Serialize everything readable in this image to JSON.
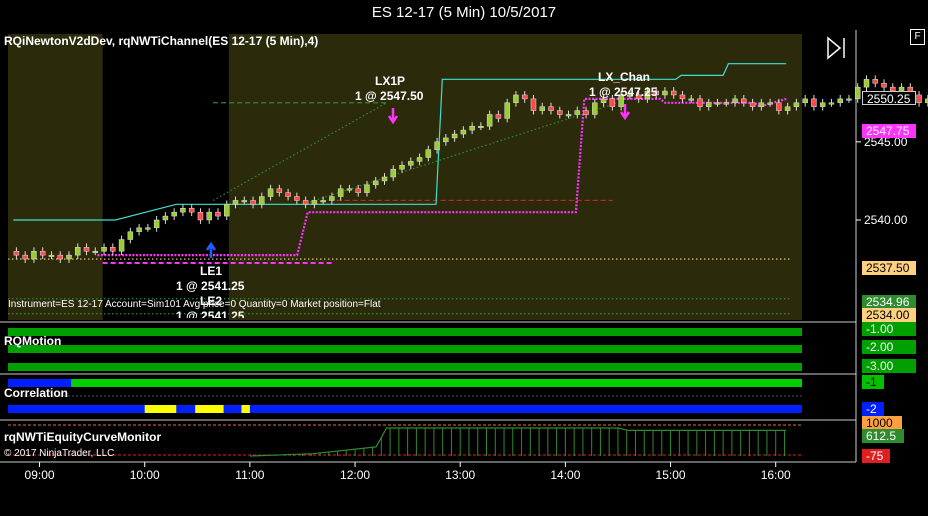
{
  "window": {
    "title": "ES 12-17 (5 Min)  10/5/2017",
    "f_button": "F"
  },
  "panels": {
    "price_title": "RQiNewtonV2dDev, rqNWTiChannel(ES 12-17 (5 Min),4)",
    "motion_title": "RQMotion",
    "correlation_title": "Correlation",
    "equity_title": "rqNWTiEquityCurveMonitor",
    "status_line": "Instrument=ES 12-17  Account=Sim101  Avg price=0 Quantity=0 Market position=Flat",
    "copyright": "© 2017 NinjaTrader, LLC"
  },
  "trades": {
    "entry_1": {
      "name": "LE1",
      "price": "1 @ 2541.25"
    },
    "entry_2": {
      "name": "LE2",
      "price": "1 @ 2541.25"
    },
    "exit_1": {
      "name": "LX1P",
      "price": "1 @ 2547.50"
    },
    "exit_2": {
      "name": "LX_Chan",
      "price": "1 @ 2547.25"
    }
  },
  "price_markers": {
    "last": "2550.25",
    "upper_channel": "2547.75",
    "level_orange": "2537.50",
    "level_green": "2534.96",
    "level_yellow": "2534.00"
  },
  "indicator_markers": {
    "motion": [
      "-1.00",
      "-2.00",
      "-3.00"
    ],
    "correlation": [
      "-1",
      "-2"
    ],
    "equity": [
      "1000",
      "612.5",
      "-75"
    ]
  },
  "colors": {
    "session_bg": "#2b2b0b",
    "bull_candle": "#9acd32",
    "bear_candle": "#ff4a4a",
    "channel_upper": "#40e0d0",
    "channel_lower": "#ff33ff",
    "motion_green": "#00a000",
    "correlation_blue": "#0020ff",
    "correlation_yellow": "#ffff00",
    "equity_green": "#2e8b2e"
  },
  "chart_data": {
    "type": "candlestick",
    "instrument": "ES 12-17",
    "interval": "5 Min",
    "date": "10/5/2017",
    "x_tick_labels": [
      "09:00",
      "10:00",
      "11:00",
      "12:00",
      "13:00",
      "14:00",
      "15:00",
      "16:00"
    ],
    "y_tick_labels": [
      "2545.00",
      "2540.00"
    ],
    "y_range": [
      2533.6,
      2551.9
    ],
    "time_range_hours": [
      8.7,
      16.25
    ],
    "bar_minutes": 5,
    "approx_closes": [
      2537.75,
      2537.5,
      2538.0,
      2537.75,
      2537.75,
      2537.5,
      2537.75,
      2538.25,
      2538.0,
      2538.0,
      2538.25,
      2538.0,
      2538.75,
      2539.25,
      2539.5,
      2539.5,
      2540.0,
      2540.25,
      2540.5,
      2540.75,
      2540.5,
      2540.0,
      2540.5,
      2540.25,
      2541.0,
      2541.25,
      2541.25,
      2541.0,
      2541.5,
      2542.0,
      2541.75,
      2541.5,
      2541.25,
      2541.0,
      2541.25,
      2541.25,
      2541.5,
      2542.0,
      2542.0,
      2541.75,
      2542.25,
      2542.5,
      2542.75,
      2543.25,
      2543.5,
      2543.75,
      2544.0,
      2544.5,
      2545.0,
      2545.25,
      2545.5,
      2545.75,
      2546.0,
      2546.0,
      2546.75,
      2546.5,
      2547.5,
      2548.0,
      2547.75,
      2547.0,
      2547.25,
      2547.0,
      2546.75,
      2546.75,
      2547.0,
      2546.75,
      2547.5,
      2547.75,
      2547.25,
      2548.0,
      2548.0,
      2547.75,
      2548.25,
      2548.0,
      2548.25,
      2548.0,
      2547.75,
      2547.75,
      2547.25,
      2547.5,
      2547.5,
      2547.5,
      2547.75,
      2547.5,
      2547.25,
      2547.5,
      2547.5,
      2547.0,
      2547.25,
      2547.5,
      2547.75,
      2547.25,
      2547.5,
      2547.5,
      2547.75,
      2547.75,
      2548.5,
      2549.0,
      2548.75,
      2548.5,
      2548.25,
      2548.5,
      2548.0,
      2547.5,
      2547.75,
      2547.5,
      2547.5,
      2547.75,
      2548.0,
      2548.25,
      2547.75,
      2548.5,
      2549.5,
      2550.25
    ],
    "channel_upper": [
      {
        "t": 8.75,
        "v": 2540.0
      },
      {
        "t": 9.4,
        "v": 2540.0
      },
      {
        "t": 9.72,
        "v": 2540.0
      },
      {
        "t": 10.3,
        "v": 2541.0
      },
      {
        "t": 11.2,
        "v": 2541.0
      },
      {
        "t": 11.25,
        "v": 2541.0
      },
      {
        "t": 12.77,
        "v": 2541.0
      },
      {
        "t": 12.83,
        "v": 2549.0
      },
      {
        "t": 15.05,
        "v": 2549.0
      },
      {
        "t": 15.1,
        "v": 2549.25
      },
      {
        "t": 15.5,
        "v": 2549.25
      },
      {
        "t": 15.55,
        "v": 2550.0
      },
      {
        "t": 16.1,
        "v": 2550.0
      }
    ],
    "channel_lower": [
      {
        "t": 9.55,
        "v": 2537.75
      },
      {
        "t": 11.45,
        "v": 2537.75
      },
      {
        "t": 11.55,
        "v": 2540.5
      },
      {
        "t": 14.1,
        "v": 2540.5
      },
      {
        "t": 14.18,
        "v": 2547.75
      },
      {
        "t": 14.9,
        "v": 2547.75
      },
      {
        "t": 14.95,
        "v": 2547.5
      },
      {
        "t": 15.8,
        "v": 2547.5
      },
      {
        "t": 15.85,
        "v": 2547.25
      },
      {
        "t": 16.1,
        "v": 2547.75
      }
    ],
    "lines": [
      {
        "kind": "dashed",
        "color": "#2e8b2e",
        "t1": 10.65,
        "t2": 12.3,
        "v": 2547.5
      },
      {
        "kind": "dashed",
        "color": "#d02020",
        "t1": 11.75,
        "t2": 14.45,
        "v": 2541.25
      },
      {
        "kind": "dashed",
        "color": "#ff33ff",
        "t1": 9.6,
        "t2": 11.8,
        "v": 2537.25
      },
      {
        "kind": "dotted",
        "color": "#ffd080",
        "t1": 8.7,
        "t2": 16.15,
        "v": 2537.5
      },
      {
        "kind": "dotted",
        "color": "#2e8b2e",
        "t1": 10.65,
        "t2": 12.3,
        "v2a": 2541.25,
        "v2b": 2547.5
      },
      {
        "kind": "dotted",
        "color": "#2e8b2e",
        "t1": 11.5,
        "t2": 14.5,
        "v2a": 2541.0,
        "v2b": 2547.5
      },
      {
        "kind": "dotted",
        "color": "#2e8b2e",
        "t1": 8.7,
        "t2": 16.15,
        "v": 2534.96
      },
      {
        "kind": "dotted",
        "color": "#2e8b2e",
        "t1": 8.7,
        "t2": 16.15,
        "v": 2534.0
      }
    ],
    "equity_curve_points": [
      {
        "t": 11.0,
        "v": 0
      },
      {
        "t": 11.6,
        "v": 50
      },
      {
        "t": 12.2,
        "v": 200
      },
      {
        "t": 12.3,
        "v": 612.5
      },
      {
        "t": 14.5,
        "v": 612.5
      },
      {
        "t": 14.6,
        "v": 560
      },
      {
        "t": 16.1,
        "v": 560
      }
    ],
    "correlation_yellow_segments": [
      [
        10.0,
        10.3
      ],
      [
        10.48,
        10.75
      ],
      [
        10.92,
        11.0
      ]
    ]
  }
}
